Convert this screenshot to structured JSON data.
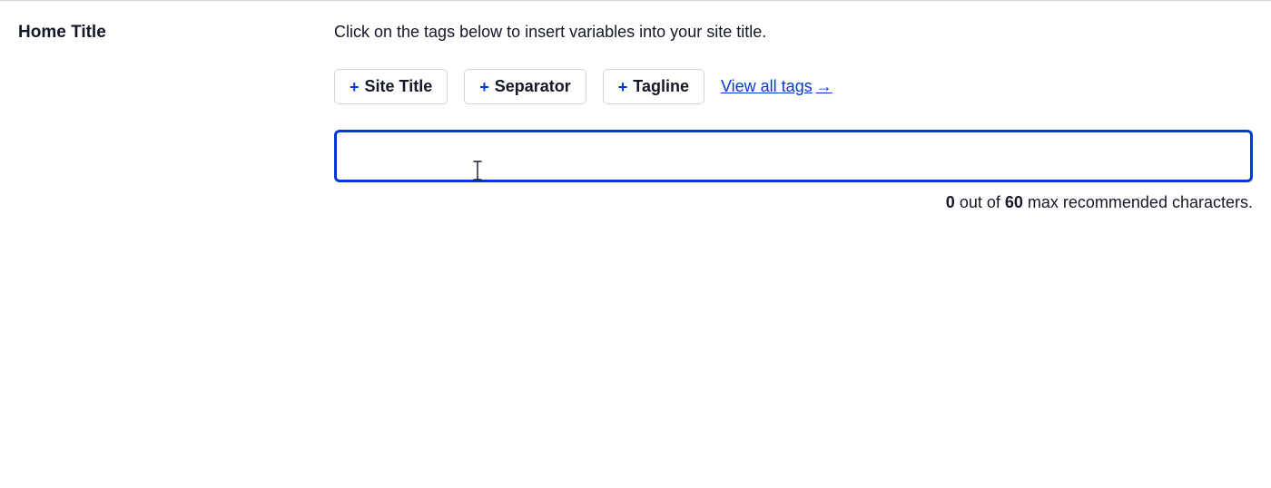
{
  "field_label": "Home Title",
  "helper_text": "Click on the tags below to insert variables into your site title.",
  "tag_buttons": [
    {
      "label": "Site Title"
    },
    {
      "label": "Separator"
    },
    {
      "label": "Tagline"
    }
  ],
  "view_all_label": "View all tags",
  "title_input": {
    "value": "",
    "placeholder": ""
  },
  "counter": {
    "current": "0",
    "middle": " out of ",
    "max": "60",
    "suffix": " max recommended characters."
  }
}
